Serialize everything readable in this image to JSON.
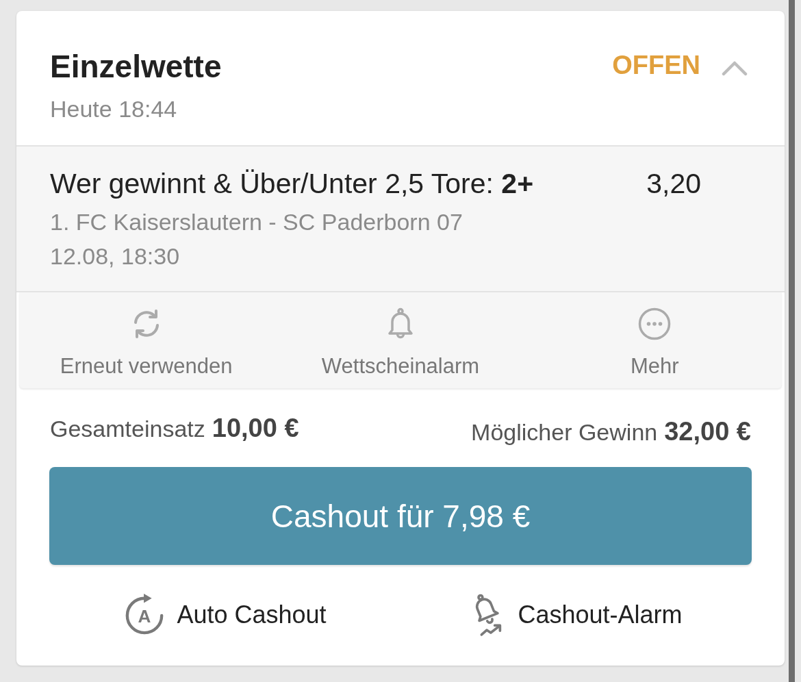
{
  "bet": {
    "title": "Einzelwette",
    "time": "Heute 18:44",
    "status": "OFFEN",
    "expanded": true
  },
  "selection": {
    "market": "Wer gewinnt & Über/Unter 2,5 Tore: **2+**",
    "odds": "3,20",
    "event": "1. FC Kaiserslautern - SC Paderborn 07",
    "date": "12.08, 18:30"
  },
  "actions": [
    {
      "kind": "reuse",
      "label": "Erneut verwenden"
    },
    {
      "kind": "alert",
      "label": "Wettscheinalarm"
    },
    {
      "kind": "more",
      "label": "Mehr"
    }
  ],
  "totals": [
    {
      "label": "Gesamteinsatz",
      "value": "10,00 €"
    },
    {
      "label": "Möglicher Gewinn",
      "value": "32,00 €"
    }
  ],
  "cashout_button": {
    "label": "Cashout für 7,98 €"
  },
  "cashout_options": [
    {
      "kind": "auto",
      "label": "Auto Cashout",
      "icon_letter": "A"
    },
    {
      "kind": "alarm",
      "label": "Cashout-Alarm"
    }
  ]
}
